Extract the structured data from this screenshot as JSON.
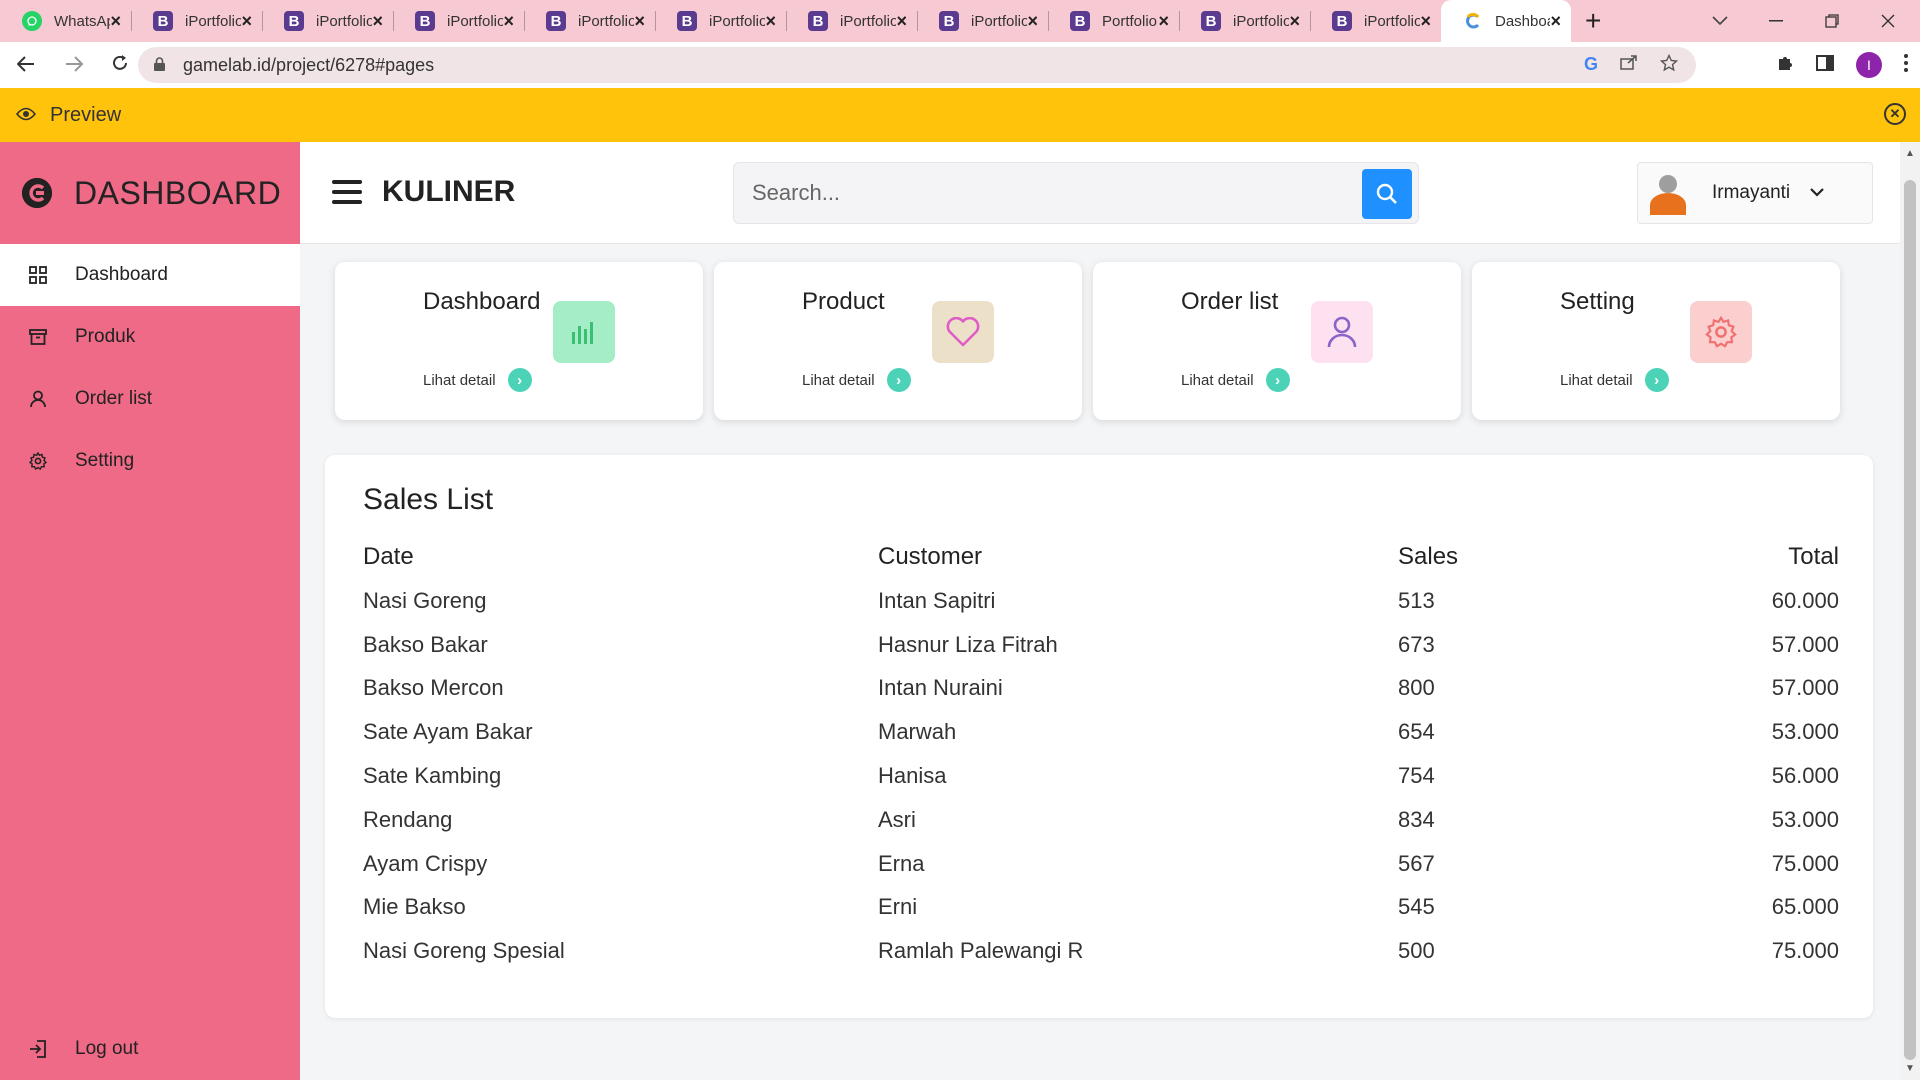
{
  "browser": {
    "tabs": [
      {
        "title": "WhatsApp",
        "favicon": "whatsapp-icon",
        "active": false
      },
      {
        "title": "iPortfolio",
        "favicon": "bootstrap-icon",
        "active": false
      },
      {
        "title": "iPortfolio",
        "favicon": "bootstrap-icon",
        "active": false
      },
      {
        "title": "iPortfolio",
        "favicon": "bootstrap-icon",
        "active": false
      },
      {
        "title": "iPortfolio",
        "favicon": "bootstrap-icon",
        "active": false
      },
      {
        "title": "iPortfolio",
        "favicon": "bootstrap-icon",
        "active": false
      },
      {
        "title": "iPortfolio",
        "favicon": "bootstrap-icon",
        "active": false
      },
      {
        "title": "iPortfolio",
        "favicon": "bootstrap-icon",
        "active": false
      },
      {
        "title": "Portfolio",
        "favicon": "bootstrap-icon",
        "active": false
      },
      {
        "title": "iPortfolio",
        "favicon": "bootstrap-icon",
        "active": false
      },
      {
        "title": "iPortfolio",
        "favicon": "bootstrap-icon",
        "active": false
      },
      {
        "title": "Dashboard",
        "favicon": "gamelab-icon",
        "active": true
      }
    ],
    "url": "gamelab.id/project/6278#pages",
    "profile_initial": "I",
    "preview_label": "Preview"
  },
  "colors": {
    "sidebar": "#ee6a86",
    "preview_bar": "#ffc30b",
    "search_button": "#1e90ff",
    "arrow": "#4cd3b7"
  },
  "sidebar": {
    "brand": "DASHBOARD",
    "brand_icon": "gamelab-logo-icon",
    "items": [
      {
        "label": "Dashboard",
        "icon": "grid-icon",
        "active": true
      },
      {
        "label": "Produk",
        "icon": "archive-icon",
        "active": false
      },
      {
        "label": "Order list",
        "icon": "user-icon",
        "active": false
      },
      {
        "label": "Setting",
        "icon": "gear-icon",
        "active": false
      }
    ],
    "logout": "Log out"
  },
  "header": {
    "title": "KULINER",
    "search_placeholder": "Search...",
    "user_name": "Irmayanti"
  },
  "cards": [
    {
      "title": "Dashboard",
      "link": "Lihat detail",
      "icon": "bar-chart-icon",
      "color": "#a4edc6"
    },
    {
      "title": "Product",
      "link": "Lihat detail",
      "icon": "heart-icon",
      "color": "#ece1c8"
    },
    {
      "title": "Order list",
      "link": "Lihat detail",
      "icon": "user-icon",
      "color": "#fde1f1"
    },
    {
      "title": "Setting",
      "link": "Lihat detail",
      "icon": "gear-icon",
      "color": "#fccfcf"
    }
  ],
  "sales": {
    "title": "Sales List",
    "columns": [
      "Date",
      "Customer",
      "Sales",
      "Total"
    ],
    "rows": [
      [
        "Nasi Goreng",
        "Intan Sapitri",
        "513",
        "60.000"
      ],
      [
        "Bakso Bakar",
        "Hasnur Liza Fitrah",
        "673",
        "57.000"
      ],
      [
        "Bakso Mercon",
        "Intan Nuraini",
        "800",
        "57.000"
      ],
      [
        "Sate Ayam Bakar",
        "Marwah",
        "654",
        "53.000"
      ],
      [
        "Sate Kambing",
        "Hanisa",
        "754",
        "56.000"
      ],
      [
        "Rendang",
        "Asri",
        "834",
        "53.000"
      ],
      [
        "Ayam Crispy",
        "Erna",
        "567",
        "75.000"
      ],
      [
        "Mie Bakso",
        "Erni",
        "545",
        "65.000"
      ],
      [
        "Nasi Goreng Spesial",
        "Ramlah Palewangi R",
        "500",
        "75.000"
      ]
    ]
  }
}
